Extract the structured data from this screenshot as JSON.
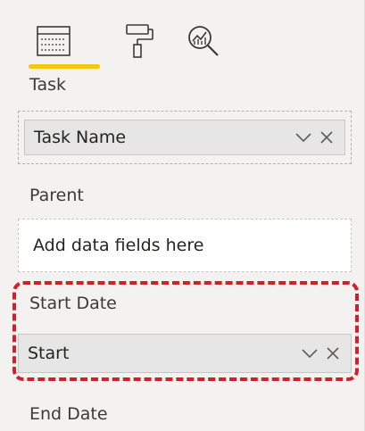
{
  "toolbar": {
    "tools": [
      {
        "name": "fields",
        "icon": "fields-icon"
      },
      {
        "name": "format",
        "icon": "paint-roller-icon"
      },
      {
        "name": "analytics",
        "icon": "analytics-icon"
      }
    ],
    "active_color": "#f2c811"
  },
  "wells": {
    "task": {
      "label": "Task",
      "field": "Task Name"
    },
    "parent": {
      "label": "Parent",
      "placeholder": "Add data fields here"
    },
    "start_date": {
      "label": "Start Date",
      "field": "Start"
    },
    "end_date": {
      "label": "End Date"
    }
  },
  "highlight_color": "#d1202a"
}
